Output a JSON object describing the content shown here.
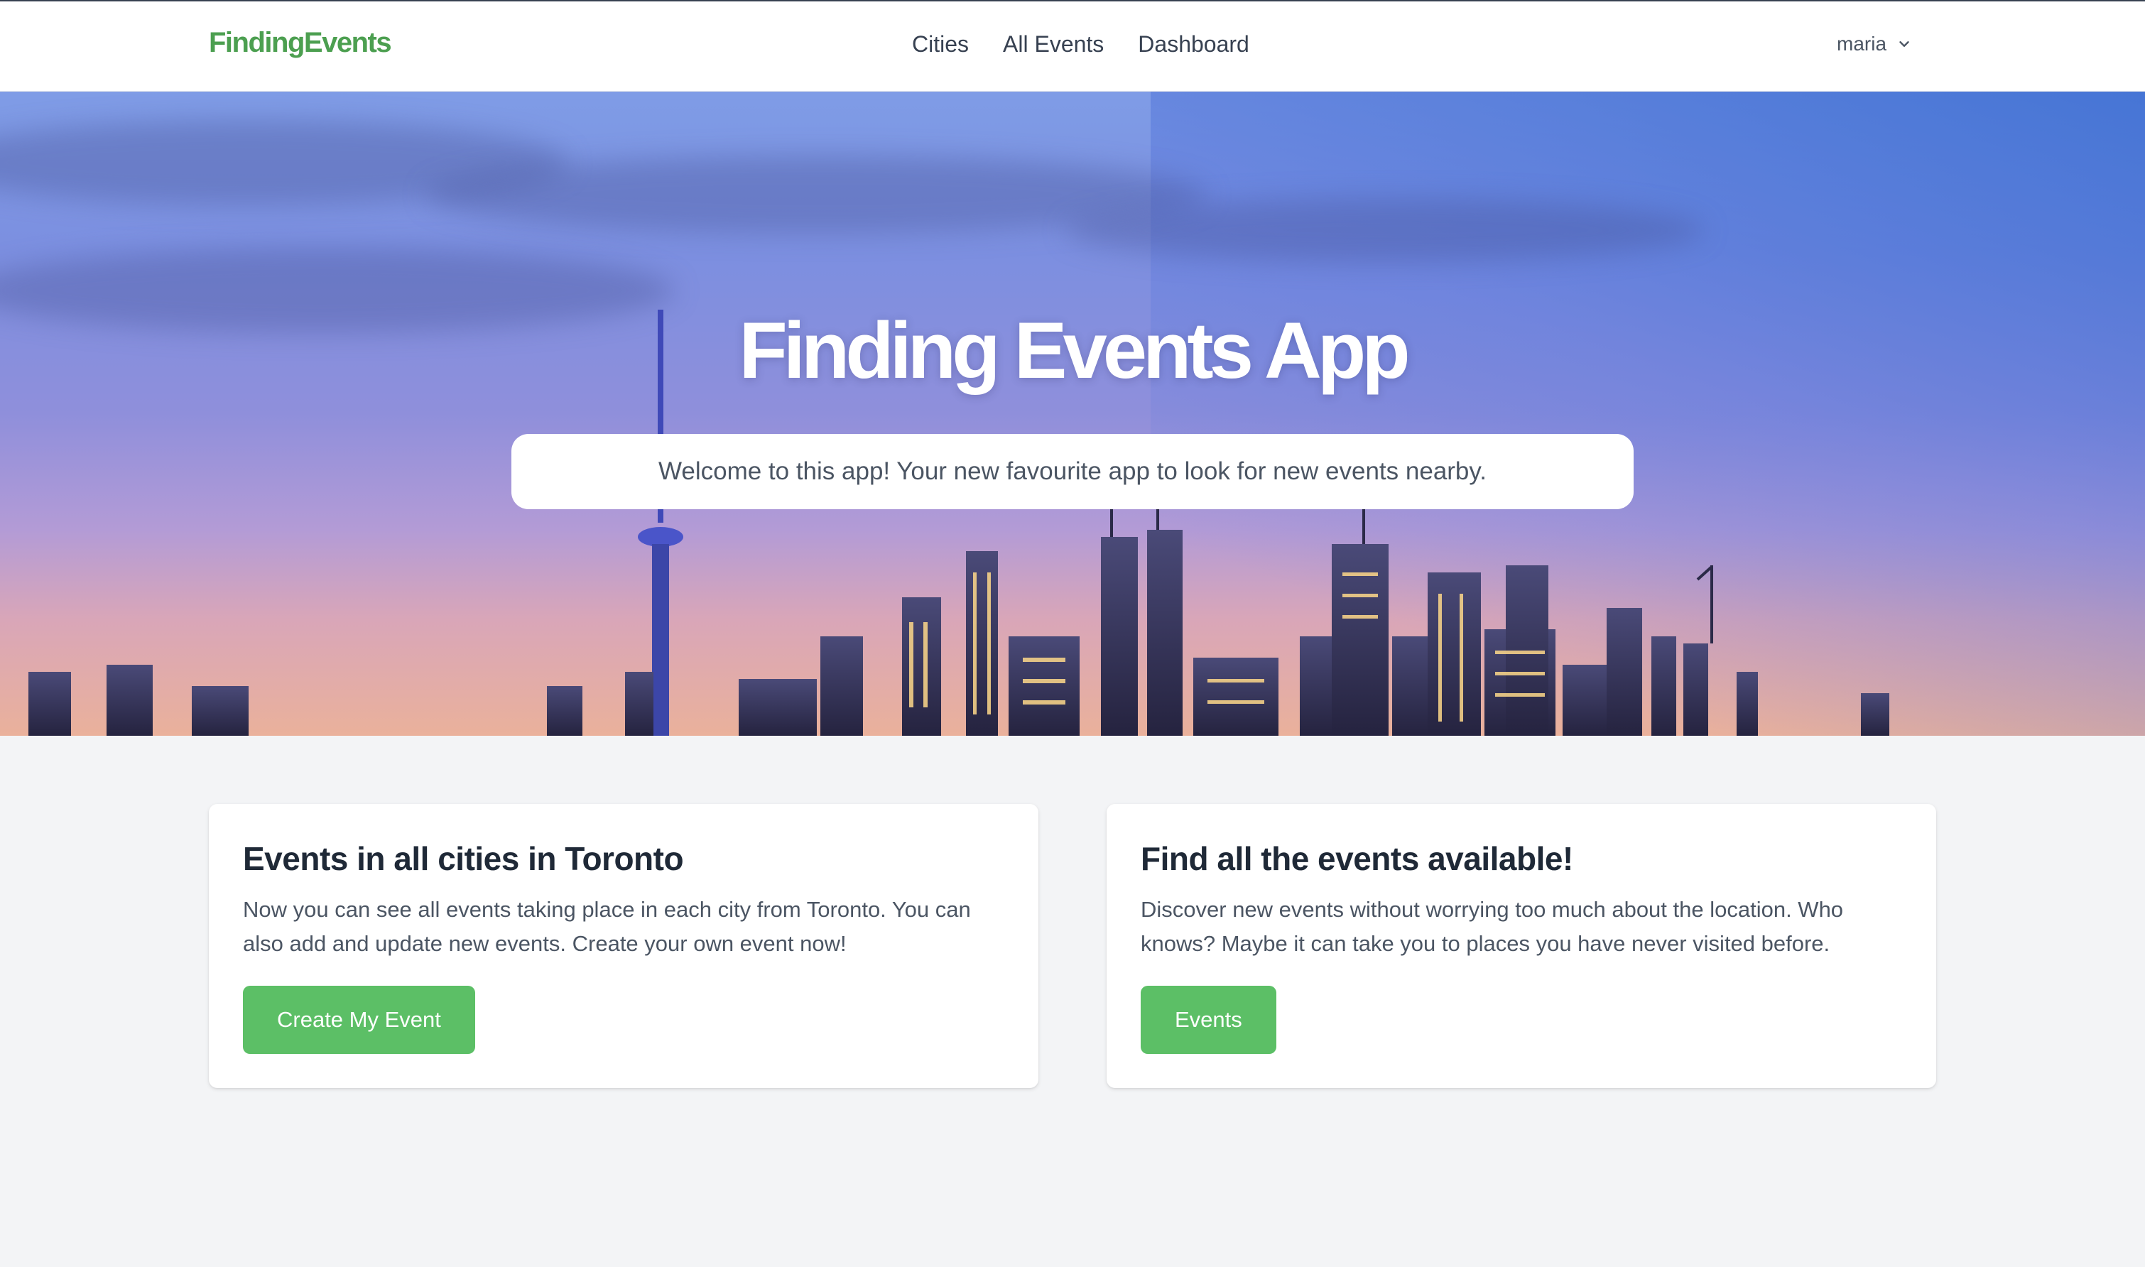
{
  "navbar": {
    "brand": "FindingEvents",
    "links": [
      {
        "label": "Cities"
      },
      {
        "label": "All Events"
      },
      {
        "label": "Dashboard"
      }
    ],
    "user": {
      "name": "maria",
      "icon": "chevron-down-icon"
    }
  },
  "hero": {
    "title": "Finding Events App",
    "subtitle": "Welcome to this app! Your new favourite app to look for new events nearby."
  },
  "cards": [
    {
      "title": "Events in all cities in Toronto",
      "text": "Now you can see all events taking place in each city from Toronto. You can also add and update new events. Create your own event now!",
      "button": "Create My Event"
    },
    {
      "title": "Find all the events available!",
      "text": "Discover new events without worrying too much about the location. Who knows? Maybe it can take you to places you have never visited before.",
      "button": "Events"
    }
  ],
  "colors": {
    "brand": "#4c9f50",
    "button": "#5cbf66",
    "page_background": "#f3f4f6"
  }
}
